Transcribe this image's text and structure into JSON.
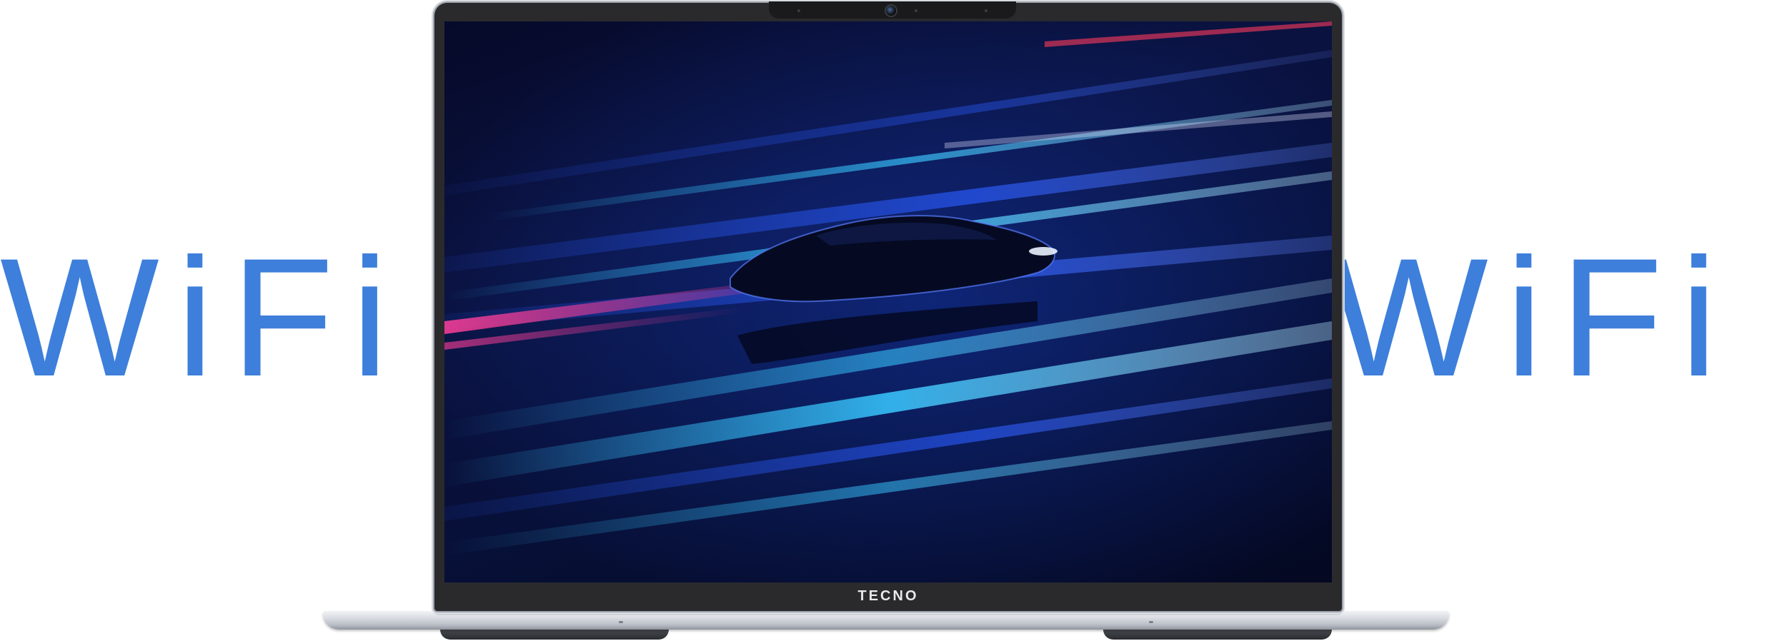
{
  "promo": {
    "headline_left": "WiFi 6",
    "headline_right": "WiFi 6",
    "headline_color": "#3d7fdb"
  },
  "device": {
    "brand_label": "TECNO",
    "bezel_color": "#2a2a2d",
    "body_color": "#d7dae0"
  },
  "wallpaper": {
    "description_icon": "speeding-car-light-trails",
    "accent_cyan": "#38c8ff",
    "accent_blue": "#2a5cff",
    "accent_pink": "#ff3f9a"
  }
}
